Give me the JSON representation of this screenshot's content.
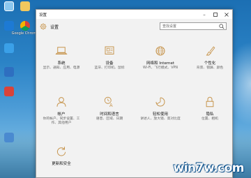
{
  "window": {
    "title": "设置",
    "header_title": "设置",
    "search_placeholder": "查找设置"
  },
  "tiles": [
    {
      "name": "系统",
      "desc": "显示、通知、应用、电源",
      "icon": "laptop-icon"
    },
    {
      "name": "设备",
      "desc": "蓝牙、打印机、鼠标",
      "icon": "keyboard-icon"
    },
    {
      "name": "网络和 Internet",
      "desc": "Wi-Fi、飞行模式、VPN",
      "icon": "globe-icon"
    },
    {
      "name": "个性化",
      "desc": "背景、锁屏、颜色",
      "icon": "paint-icon"
    },
    {
      "name": "帐户",
      "desc": "你的帐户、同步设置、工作、其他用户",
      "icon": "person-icon"
    },
    {
      "name": "时间和语言",
      "desc": "语音、区域、日期",
      "icon": "time-language-icon"
    },
    {
      "name": "轻松使用",
      "desc": "讲述人、放大镜、高对比度",
      "icon": "ease-of-access-icon"
    },
    {
      "name": "隐私",
      "desc": "位置、相机",
      "icon": "lock-icon"
    },
    {
      "name": "更新和安全",
      "desc": "",
      "icon": "refresh-icon"
    }
  ],
  "desktop": {
    "icons": [
      "",
      "Google Chrome",
      "",
      "",
      "",
      ""
    ]
  },
  "watermark": "win7w.com",
  "colors": {
    "accent": "#c6934a",
    "window_bg": "#f2f2f2"
  }
}
